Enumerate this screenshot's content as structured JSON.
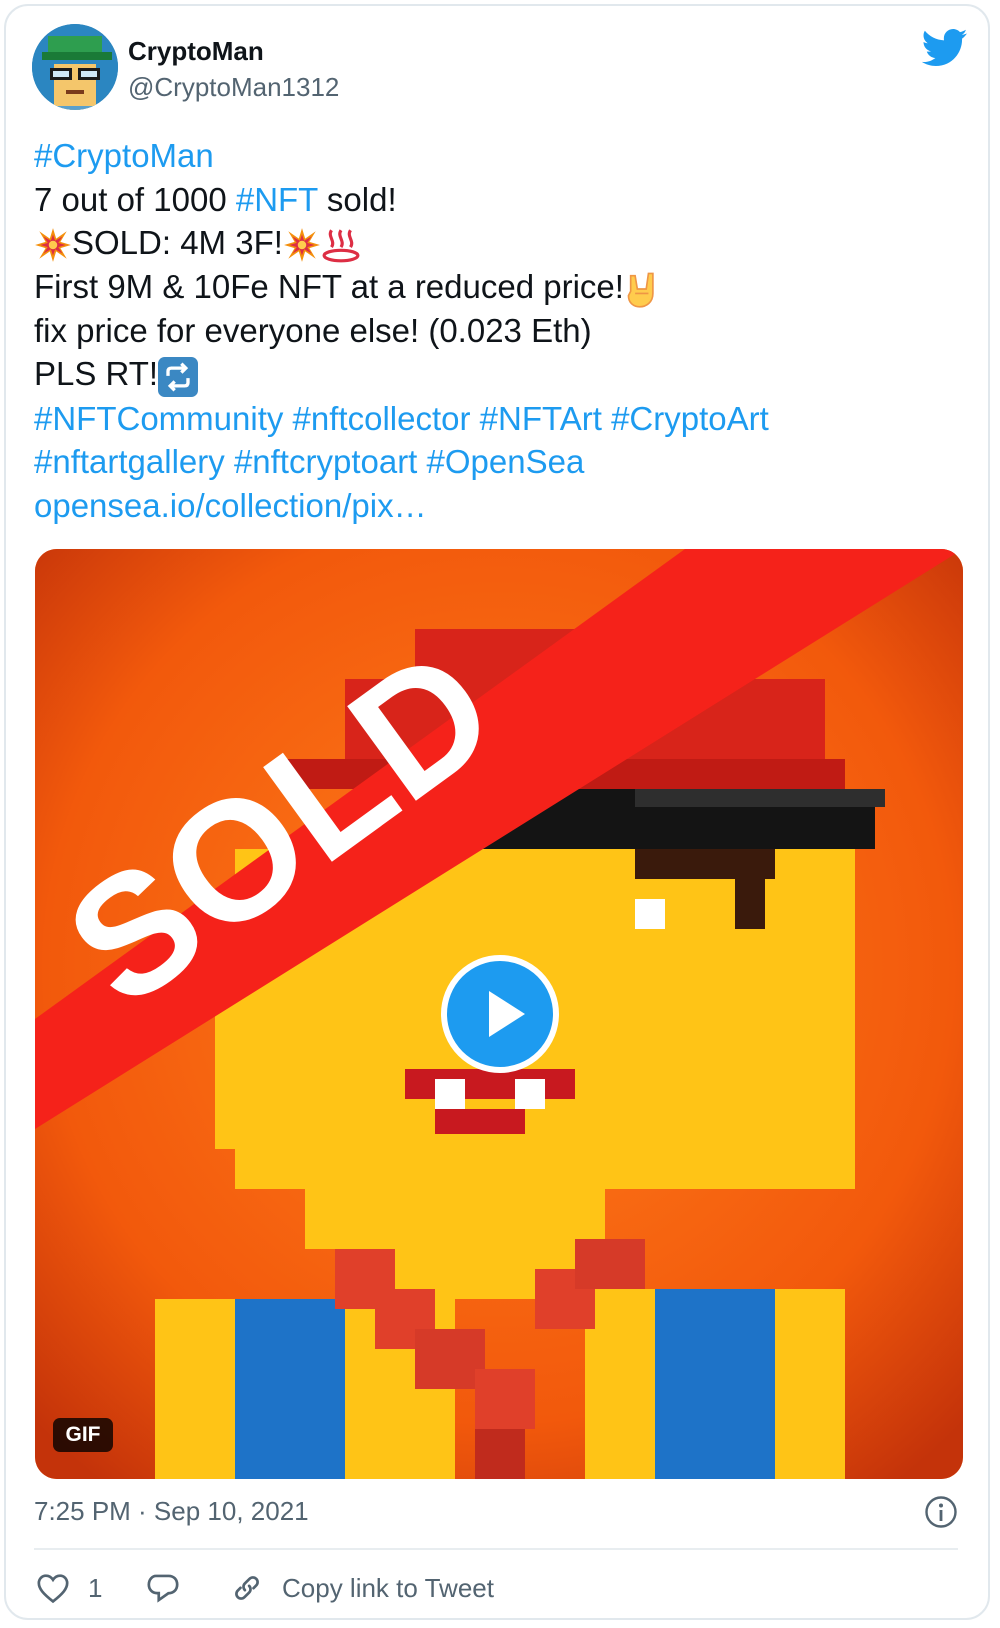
{
  "tweet": {
    "author": {
      "name": "CryptoMan",
      "handle": "@CryptoMan1312"
    },
    "lines": {
      "l1_tag": "#CryptoMan",
      "l2_a": "7 out of 1000 ",
      "l2_tag": "#NFT",
      "l2_b": " sold!",
      "l3_text": "SOLD: 4M 3F!",
      "l4_text": "First 9M & 10Fe NFT at a reduced price!",
      "l5_text": "fix price for everyone else! (0.023 Eth)",
      "l6_text": "PLS RT!",
      "l7_tags": [
        "#NFTCommunity",
        "#nftcollector",
        "#NFTArt",
        "#CryptoArt"
      ],
      "l8_tags": [
        "#nftartgallery",
        "#nftcryptoart",
        "#OpenSea"
      ],
      "url": "opensea.io/collection/pix…"
    },
    "media": {
      "overlay_text": "SOLD",
      "badge": "GIF"
    },
    "timestamp": "7:25 PM · Sep 10, 2021",
    "actions": {
      "like_count": "1",
      "copy_link_label": "Copy link to Tweet"
    }
  },
  "icons": {
    "brand": "twitter-bird-icon",
    "emoji": [
      "collision-emoji",
      "hot-springs-emoji",
      "sign-of-horns-emoji",
      "repeat-emoji"
    ],
    "controls": [
      "play-icon",
      "info-icon",
      "heart-icon",
      "reply-icon",
      "link-icon"
    ]
  },
  "colors": {
    "link": "#1d9bf0",
    "secondary_text": "#536471",
    "brand": "#1d9bf0"
  }
}
